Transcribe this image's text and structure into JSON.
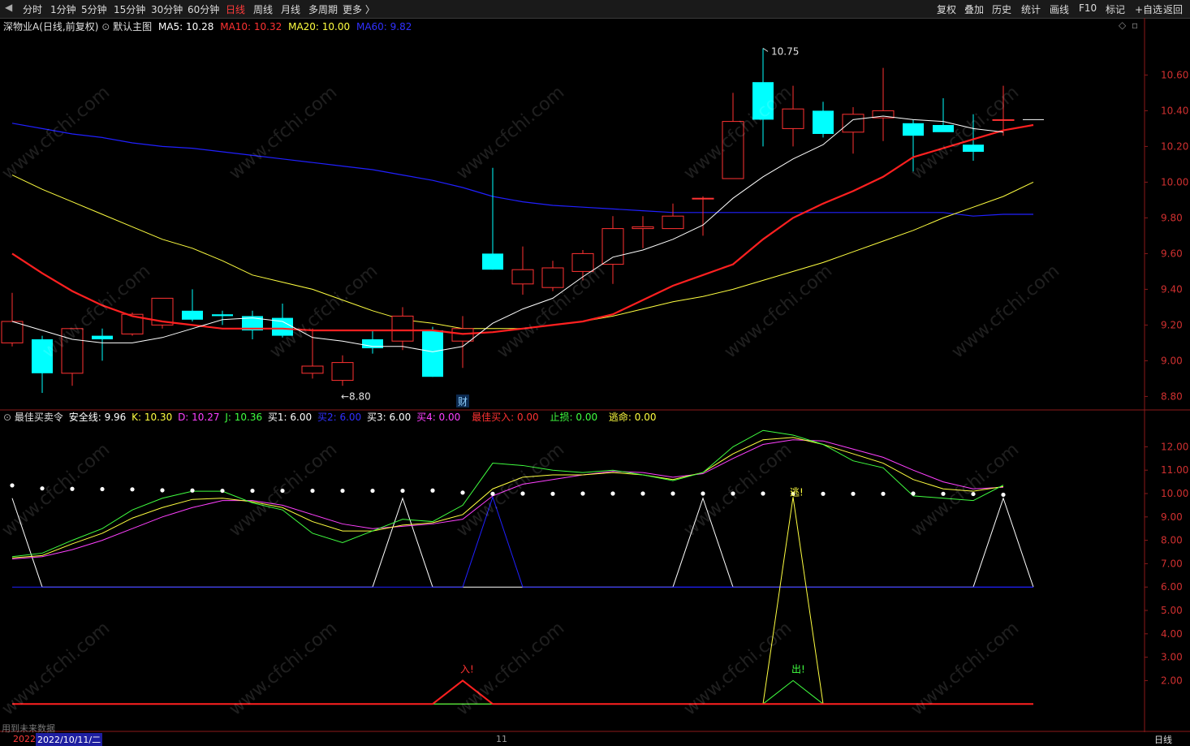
{
  "toolbar": {
    "back_icon": "back-arrow-icon",
    "left_items": [
      "分时",
      "1分钟",
      "5分钟",
      "15分钟",
      "30分钟",
      "60分钟",
      "日线",
      "周线",
      "月线",
      "多周期",
      "更多 〉"
    ],
    "active_item": "日线",
    "right_items": [
      "复权",
      "叠加",
      "历史",
      "统计",
      "画线",
      "F10",
      "标记",
      "+自选",
      "返回"
    ]
  },
  "main_header": {
    "stock": "深物业A",
    "mode": "(日线,前复权)",
    "template": "默认主图",
    "ma5": "MA5: 10.28",
    "ma10": "MA10: 10.32",
    "ma20": "MA20: 10.00",
    "ma60": "MA60: 9.82"
  },
  "price_axis": {
    "ticks": [
      "10.60",
      "10.40",
      "10.20",
      "10.00",
      "9.80",
      "9.60",
      "9.40",
      "9.20",
      "9.00",
      "8.80"
    ],
    "high_label": "10.75",
    "low_label": "8.80",
    "event_tag": "财"
  },
  "sub_header": {
    "name": "最佳买卖令",
    "safe": "安全线: 9.96",
    "k": "K: 10.30",
    "d": "D: 10.27",
    "j": "J: 10.36",
    "buy1": "买1: 6.00",
    "buy2": "买2: 6.00",
    "buy3": "买3: 6.00",
    "buy4": "买4: 0.00",
    "best_buy": "最佳买入: 0.00",
    "stop": "止损: 0.00",
    "escape": "逃命: 0.00"
  },
  "sub_axis": {
    "ticks": [
      "12.00",
      "11.00",
      "10.00",
      "9.00",
      "8.00",
      "7.00",
      "6.00",
      "5.00",
      "4.00",
      "3.00",
      "2.00"
    ],
    "signal_in": "入!",
    "signal_out": "出!",
    "signal_escape": "逃!"
  },
  "footer": {
    "note": "用到未来数据",
    "year": "2022",
    "date": "2022/10/11/二",
    "month_mark": "11",
    "period": "日线"
  },
  "watermark": "www.cfchi.com",
  "colors": {
    "up": "#ff3232",
    "down": "#00ffff",
    "ma5": "#ffffff",
    "ma10": "#ff2020",
    "ma20": "#ffff40",
    "ma60": "#2020ff",
    "k": "#ffff40",
    "d": "#ff40ff",
    "j": "#40ff40"
  },
  "chart_data": {
    "type": "candlestick",
    "price_range": [
      8.72,
      10.92
    ],
    "candles": [
      {
        "o": 9.1,
        "h": 9.38,
        "l": 9.08,
        "c": 9.22
      },
      {
        "o": 9.12,
        "h": 9.14,
        "l": 8.82,
        "c": 8.93
      },
      {
        "o": 8.93,
        "h": 9.18,
        "l": 8.86,
        "c": 9.18
      },
      {
        "o": 9.14,
        "h": 9.18,
        "l": 9.0,
        "c": 9.12
      },
      {
        "o": 9.15,
        "h": 9.27,
        "l": 9.14,
        "c": 9.26
      },
      {
        "o": 9.2,
        "h": 9.35,
        "l": 9.18,
        "c": 9.35
      },
      {
        "o": 9.28,
        "h": 9.4,
        "l": 9.22,
        "c": 9.23
      },
      {
        "o": 9.26,
        "h": 9.28,
        "l": 9.2,
        "c": 9.25
      },
      {
        "o": 9.25,
        "h": 9.28,
        "l": 9.12,
        "c": 9.17
      },
      {
        "o": 9.24,
        "h": 9.32,
        "l": 9.13,
        "c": 9.14
      },
      {
        "o": 8.93,
        "h": 9.18,
        "l": 8.9,
        "c": 8.97
      },
      {
        "o": 8.89,
        "h": 9.03,
        "l": 8.86,
        "c": 8.99
      },
      {
        "o": 9.12,
        "h": 9.17,
        "l": 9.04,
        "c": 9.07
      },
      {
        "o": 9.11,
        "h": 9.3,
        "l": 9.06,
        "c": 9.25
      },
      {
        "o": 9.17,
        "h": 9.19,
        "l": 8.91,
        "c": 8.91
      },
      {
        "o": 9.11,
        "h": 9.25,
        "l": 8.96,
        "c": 9.18
      },
      {
        "o": 9.6,
        "h": 10.08,
        "l": 9.51,
        "c": 9.51
      },
      {
        "o": 9.43,
        "h": 9.64,
        "l": 9.37,
        "c": 9.51
      },
      {
        "o": 9.41,
        "h": 9.56,
        "l": 9.39,
        "c": 9.52
      },
      {
        "o": 9.5,
        "h": 9.62,
        "l": 9.45,
        "c": 9.6
      },
      {
        "o": 9.54,
        "h": 9.81,
        "l": 9.43,
        "c": 9.74
      },
      {
        "o": 9.74,
        "h": 9.81,
        "l": 9.63,
        "c": 9.75
      },
      {
        "o": 9.74,
        "h": 9.88,
        "l": 9.74,
        "c": 9.81
      },
      {
        "o": 9.91,
        "h": 9.92,
        "l": 9.7,
        "c": 9.91
      },
      {
        "o": 10.02,
        "h": 10.5,
        "l": 10.02,
        "c": 10.34
      },
      {
        "o": 10.56,
        "h": 10.75,
        "l": 10.2,
        "c": 10.35
      },
      {
        "o": 10.3,
        "h": 10.54,
        "l": 10.2,
        "c": 10.41
      },
      {
        "o": 10.4,
        "h": 10.45,
        "l": 10.25,
        "c": 10.27
      },
      {
        "o": 10.28,
        "h": 10.42,
        "l": 10.16,
        "c": 10.38
      },
      {
        "o": 10.36,
        "h": 10.64,
        "l": 10.23,
        "c": 10.4
      },
      {
        "o": 10.33,
        "h": 10.35,
        "l": 10.06,
        "c": 10.26
      },
      {
        "o": 10.32,
        "h": 10.47,
        "l": 10.29,
        "c": 10.28
      },
      {
        "o": 10.21,
        "h": 10.38,
        "l": 10.12,
        "c": 10.17
      },
      {
        "o": 10.35,
        "h": 10.54,
        "l": 10.26,
        "c": 10.35
      }
    ],
    "ma5": [
      9.22,
      9.17,
      9.12,
      9.1,
      9.1,
      9.13,
      9.18,
      9.23,
      9.24,
      9.22,
      9.13,
      9.11,
      9.08,
      9.08,
      9.05,
      9.08,
      9.21,
      9.29,
      9.35,
      9.47,
      9.58,
      9.62,
      9.68,
      9.76,
      9.91,
      10.03,
      10.13,
      10.21,
      10.35,
      10.37,
      10.35,
      10.34,
      10.3,
      10.28
    ],
    "ma10": [
      9.6,
      9.49,
      9.39,
      9.31,
      9.25,
      9.22,
      9.2,
      9.18,
      9.18,
      9.18,
      9.17,
      9.17,
      9.17,
      9.17,
      9.17,
      9.15,
      9.16,
      9.18,
      9.2,
      9.22,
      9.26,
      9.34,
      9.42,
      9.48,
      9.54,
      9.68,
      9.8,
      9.88,
      9.95,
      10.03,
      10.14,
      10.19,
      10.24,
      10.29,
      10.32
    ],
    "ma20": [
      10.04,
      9.96,
      9.89,
      9.82,
      9.75,
      9.68,
      9.63,
      9.56,
      9.48,
      9.44,
      9.4,
      9.34,
      9.28,
      9.23,
      9.21,
      9.18,
      9.18,
      9.18,
      9.2,
      9.22,
      9.25,
      9.29,
      9.33,
      9.36,
      9.4,
      9.45,
      9.5,
      9.55,
      9.61,
      9.67,
      9.73,
      9.8,
      9.86,
      9.92,
      10.0
    ],
    "ma60": [
      10.33,
      10.3,
      10.27,
      10.25,
      10.22,
      10.2,
      10.19,
      10.17,
      10.15,
      10.13,
      10.11,
      10.09,
      10.07,
      10.04,
      10.01,
      9.97,
      9.92,
      9.89,
      9.87,
      9.86,
      9.85,
      9.84,
      9.83,
      9.83,
      9.83,
      9.83,
      9.83,
      9.83,
      9.83,
      9.83,
      9.83,
      9.83,
      9.81,
      9.82,
      9.82
    ],
    "sub_range": [
      1.0,
      13.0
    ],
    "safe_line": [
      10.35,
      10.22,
      10.2,
      10.19,
      10.18,
      10.14,
      10.13,
      10.12,
      10.12,
      10.12,
      10.12,
      10.12,
      10.12,
      10.12,
      10.13,
      10.04,
      9.99,
      10.0,
      9.99,
      10.0,
      10.0,
      10.0,
      10.0,
      10.0,
      10.0,
      10.0,
      9.99,
      9.99,
      9.99,
      9.99,
      10.0,
      9.99,
      9.98,
      9.95
    ],
    "k": [
      7.25,
      7.35,
      7.85,
      8.3,
      8.95,
      9.4,
      9.75,
      9.8,
      9.65,
      9.4,
      8.8,
      8.4,
      8.4,
      8.65,
      8.75,
      9.1,
      10.2,
      10.7,
      10.8,
      10.8,
      10.9,
      10.8,
      10.6,
      10.9,
      11.7,
      12.3,
      12.4,
      12.1,
      11.7,
      11.3,
      10.6,
      10.2,
      10.1,
      10.3
    ],
    "d": [
      7.2,
      7.3,
      7.6,
      8.0,
      8.5,
      9.0,
      9.4,
      9.7,
      9.7,
      9.5,
      9.1,
      8.7,
      8.5,
      8.6,
      8.7,
      8.9,
      9.9,
      10.4,
      10.6,
      10.8,
      10.95,
      10.9,
      10.7,
      10.85,
      11.5,
      12.1,
      12.3,
      12.25,
      11.9,
      11.55,
      11.0,
      10.5,
      10.2,
      10.27
    ],
    "j": [
      7.3,
      7.45,
      8.0,
      8.5,
      9.3,
      9.8,
      10.1,
      10.1,
      9.6,
      9.3,
      8.3,
      7.9,
      8.4,
      8.9,
      8.8,
      9.5,
      11.3,
      11.2,
      11.0,
      10.9,
      11.0,
      10.8,
      10.55,
      10.9,
      12.0,
      12.7,
      12.5,
      12.1,
      11.4,
      11.1,
      9.9,
      9.8,
      9.7,
      10.36
    ],
    "buy_white": [
      9.8,
      6.0,
      6.0,
      6.0,
      6.0,
      6.0,
      6.0,
      6.0,
      6.0,
      6.0,
      6.0,
      6.0,
      6.0,
      9.8,
      6.0,
      6.0,
      6.0,
      6.0,
      6.0,
      6.0,
      6.0,
      6.0,
      6.0,
      9.8,
      6.0,
      6.0,
      6.0,
      6.0,
      6.0,
      6.0,
      6.0,
      6.0,
      6.0,
      9.8,
      6.0
    ],
    "buy_blue": [
      6.0,
      6.0,
      6.0,
      6.0,
      6.0,
      6.0,
      6.0,
      6.0,
      6.0,
      6.0,
      6.0,
      6.0,
      6.0,
      6.0,
      6.0,
      6.0,
      9.85,
      6.0,
      6.0,
      6.0,
      6.0,
      6.0,
      6.0,
      6.0,
      6.0,
      6.0,
      6.0,
      6.0,
      6.0,
      6.0,
      6.0,
      6.0,
      6.0,
      6.0,
      6.0
    ],
    "escape_line": [
      1.0,
      1.0,
      1.0,
      1.0,
      1.0,
      1.0,
      1.0,
      1.0,
      1.0,
      1.0,
      1.0,
      1.0,
      1.0,
      1.0,
      1.0,
      1.0,
      1.0,
      1.0,
      1.0,
      1.0,
      1.0,
      1.0,
      1.0,
      1.0,
      1.0,
      1.0,
      9.85,
      1.0,
      1.0,
      1.0,
      1.0,
      1.0,
      1.0,
      1.0,
      1.0
    ],
    "best_buy": [
      1.0,
      1.0,
      1.0,
      1.0,
      1.0,
      1.0,
      1.0,
      1.0,
      1.0,
      1.0,
      1.0,
      1.0,
      1.0,
      1.0,
      1.0,
      2.0,
      1.0,
      1.0,
      1.0,
      1.0,
      1.0,
      1.0,
      1.0,
      1.0,
      1.0,
      1.0,
      1.0,
      1.0,
      1.0,
      1.0,
      1.0,
      1.0,
      1.0,
      1.0,
      1.0
    ],
    "stop": [
      1.0,
      1.0,
      1.0,
      1.0,
      1.0,
      1.0,
      1.0,
      1.0,
      1.0,
      1.0,
      1.0,
      1.0,
      1.0,
      1.0,
      1.0,
      1.0,
      1.0,
      1.0,
      1.0,
      1.0,
      1.0,
      1.0,
      1.0,
      1.0,
      1.0,
      1.0,
      2.0,
      1.0,
      1.0,
      1.0,
      1.0,
      1.0,
      1.0,
      1.0,
      1.0
    ]
  }
}
